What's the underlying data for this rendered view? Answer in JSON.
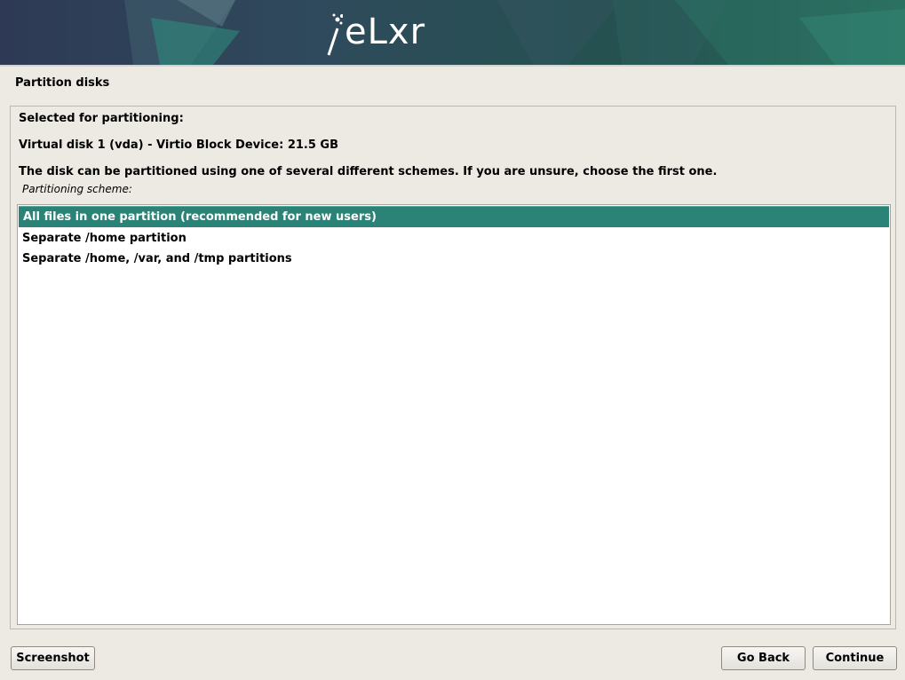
{
  "banner": {
    "logo_text": "eLxr"
  },
  "page": {
    "title": "Partition disks"
  },
  "panel": {
    "selected_heading": "Selected for partitioning:",
    "disk": "Virtual disk 1 (vda) - Virtio Block Device: 21.5 GB",
    "description": "The disk can be partitioned using one of several different schemes. If you are unsure, choose the first one.",
    "scheme_label": "Partitioning scheme:",
    "options": [
      {
        "label": "All files in one partition (recommended for new users)",
        "selected": true
      },
      {
        "label": "Separate /home partition",
        "selected": false
      },
      {
        "label": "Separate /home, /var, and /tmp partitions",
        "selected": false
      }
    ]
  },
  "buttons": {
    "screenshot": "Screenshot",
    "go_back": "Go Back",
    "continue": "Continue"
  },
  "colors": {
    "selection": "#2b8377",
    "background": "#edeae4",
    "banner_dark": "#2e3a55",
    "banner_teal": "#2a6d5e"
  }
}
